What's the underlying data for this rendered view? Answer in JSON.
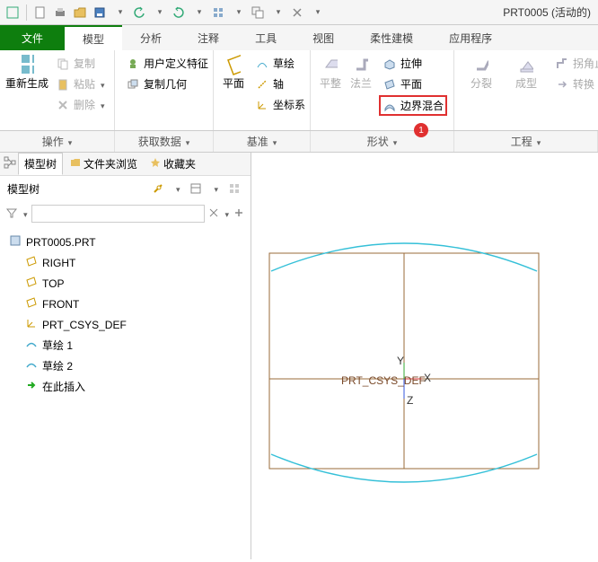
{
  "title": "PRT0005 (活动的)",
  "qat_icons": [
    "window-icon",
    "new-icon",
    "print-icon",
    "open-icon",
    "save-icon",
    "undo-icon",
    "redo-icon",
    "regen-icon",
    "windows-icon",
    "close-icon"
  ],
  "tabs": {
    "file": "文件",
    "model": "模型",
    "analysis": "分析",
    "annotate": "注释",
    "tools": "工具",
    "view": "视图",
    "flex": "柔性建模",
    "apps": "应用程序"
  },
  "ribbon": {
    "regen": "重新生成",
    "copy": "复制",
    "paste": "粘贴",
    "delete": "删除",
    "udf": "用户定义特征",
    "copy_geom": "复制几何",
    "plane": "平面",
    "sketch": "草绘",
    "axis": "轴",
    "csys": "坐标系",
    "flat": "平整",
    "flange": "法兰",
    "extrude": "拉伸",
    "plane2": "平面",
    "boundary_blend": "边界混合",
    "split": "分裂",
    "form": "成型",
    "corner_relief": "拐角止裂",
    "convert": "转换"
  },
  "groups": {
    "ops": "操作",
    "datum_getdata": "获取数据",
    "datum": "基准",
    "shape": "形状",
    "engineering": "工程"
  },
  "badge": "1",
  "side_tabs": {
    "tree": "模型树",
    "folder": "文件夹浏览",
    "favorites": "收藏夹"
  },
  "tree_title": "模型树",
  "filter_placeholder": "",
  "tree_root": "PRT0005.PRT",
  "tree_items": [
    "RIGHT",
    "TOP",
    "FRONT",
    "PRT_CSYS_DEF",
    "草绘 1",
    "草绘 2",
    "在此插入"
  ],
  "csys_label": "PRT_CSYS_DEF",
  "axes": {
    "x": "X",
    "y": "Y",
    "z": "Z"
  }
}
